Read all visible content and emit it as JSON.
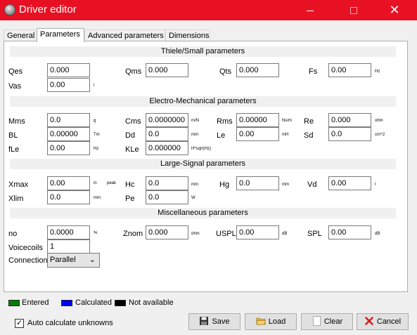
{
  "window": {
    "title": "Driver editor"
  },
  "tabs": [
    "General",
    "Parameters",
    "Advanced parameters",
    "Dimensions"
  ],
  "sections": {
    "ts": "Thiele/Small parameters",
    "em": "Electro-Mechanical parameters",
    "ls": "Large-Signal parameters",
    "misc": "Miscellaneous parameters"
  },
  "params": {
    "qes": {
      "label": "Qes",
      "value": "0.000"
    },
    "qms": {
      "label": "Qms",
      "value": "0.000"
    },
    "qts": {
      "label": "Qts",
      "value": "0.000"
    },
    "fs": {
      "label": "Fs",
      "value": "0.00",
      "unit": "Hz"
    },
    "vas": {
      "label": "Vas",
      "value": "0.00",
      "unit": "l"
    },
    "mms": {
      "label": "Mms",
      "value": "0.0",
      "unit": "g"
    },
    "cms": {
      "label": "Cms",
      "value": "0.0000000",
      "unit": "m/N"
    },
    "rms": {
      "label": "Rms",
      "value": "0.00000",
      "unit": "Ns/m"
    },
    "re": {
      "label": "Re",
      "value": "0.000",
      "unit": "ohm"
    },
    "bl": {
      "label": "BL",
      "value": "0.00000",
      "unit": "Tm"
    },
    "dd": {
      "label": "Dd",
      "value": "0.0",
      "unit": "mm"
    },
    "le": {
      "label": "Le",
      "value": "0.00",
      "unit": "mH"
    },
    "sd": {
      "label": "Sd",
      "value": "0.0",
      "unit": "cm^2"
    },
    "fle": {
      "label": "fLe",
      "value": "0.00",
      "unit": "Hz"
    },
    "kle": {
      "label": "KLe",
      "value": "0.000000",
      "unit": "H*sqrt(Hz)"
    },
    "xmax": {
      "label": "Xmax",
      "value": "0.00",
      "unit": "in",
      "unit2": "peak"
    },
    "hc": {
      "label": "Hc",
      "value": "0.0",
      "unit": "mm"
    },
    "hg": {
      "label": "Hg",
      "value": "0.0",
      "unit": "mm"
    },
    "vd": {
      "label": "Vd",
      "value": "0.00",
      "unit": "l"
    },
    "xlim": {
      "label": "Xlim",
      "value": "0.0",
      "unit": "mm"
    },
    "pe": {
      "label": "Pe",
      "value": "0.0",
      "unit": "W"
    },
    "no": {
      "label": "no",
      "value": "0.0000",
      "unit": "%"
    },
    "znom": {
      "label": "Znom",
      "value": "0.000",
      "unit": "ohm"
    },
    "uspl": {
      "label": "USPL",
      "value": "0.00",
      "unit": "dB"
    },
    "spl": {
      "label": "SPL",
      "value": "0.00",
      "unit": "dB"
    },
    "voicecoils": {
      "label": "Voicecoils",
      "value": "1"
    },
    "connection": {
      "label": "Connection",
      "value": "Parallel"
    }
  },
  "legend": {
    "entered": {
      "label": "Entered",
      "color": "#008000"
    },
    "calculated": {
      "label": "Calculated",
      "color": "#0000ff"
    },
    "not_available": {
      "label": "Not available",
      "color": "#000000"
    }
  },
  "auto_calc": {
    "label": "Auto calculate unknowns",
    "checked": true
  },
  "buttons": {
    "save": "Save",
    "load": "Load",
    "clear": "Clear",
    "cancel": "Cancel"
  }
}
